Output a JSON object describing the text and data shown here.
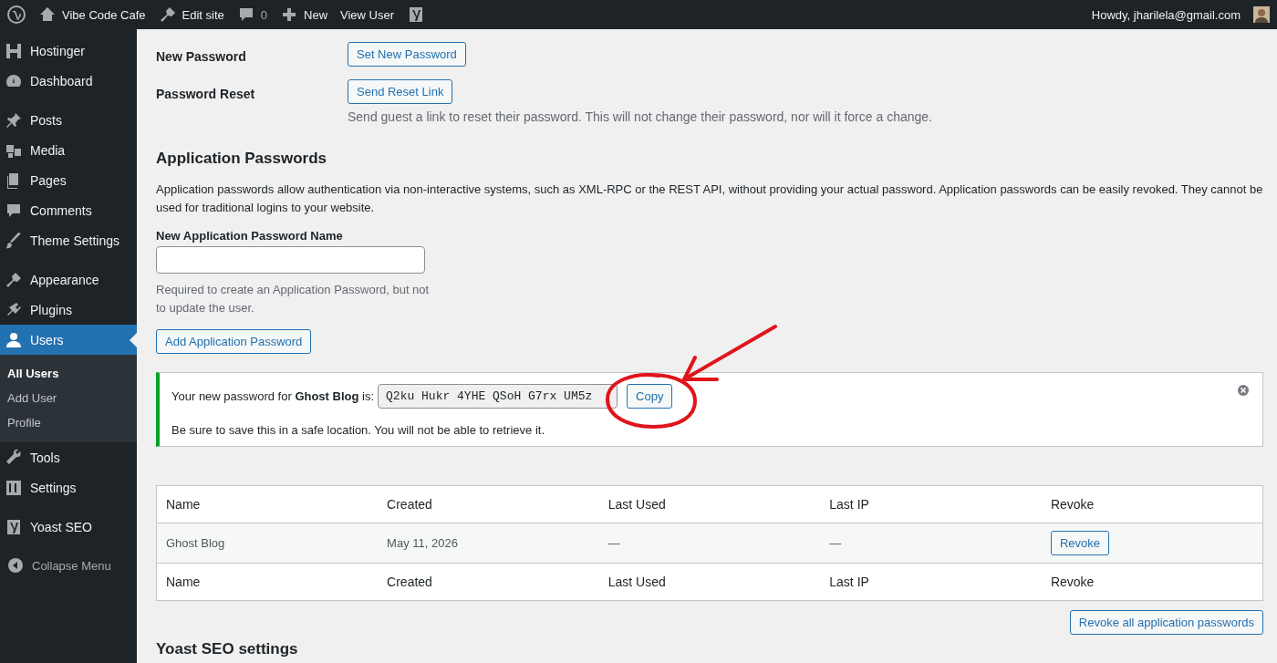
{
  "admin_bar": {
    "site_name": "Vibe Code Cafe",
    "edit_site": "Edit site",
    "comments_count": "0",
    "new": "New",
    "view_user": "View User",
    "howdy": "Howdy, jharilela@gmail.com"
  },
  "sidebar": {
    "sections": [
      [
        {
          "label": "Hostinger",
          "selected": false
        },
        {
          "label": "Dashboard",
          "selected": false
        }
      ],
      [
        {
          "label": "Posts",
          "selected": false
        },
        {
          "label": "Media",
          "selected": false
        },
        {
          "label": "Pages",
          "selected": false
        },
        {
          "label": "Comments",
          "selected": false
        },
        {
          "label": "Theme Settings",
          "selected": false
        }
      ],
      [
        {
          "label": "Appearance",
          "selected": false
        },
        {
          "label": "Plugins",
          "selected": false
        },
        {
          "label": "Users",
          "selected": true,
          "children": [
            {
              "label": "All Users",
              "selected": true
            },
            {
              "label": "Add User",
              "selected": false
            },
            {
              "label": "Profile",
              "selected": false
            }
          ]
        },
        {
          "label": "Tools",
          "selected": false
        },
        {
          "label": "Settings",
          "selected": false
        }
      ],
      [
        {
          "label": "Yoast SEO",
          "selected": false
        }
      ]
    ],
    "collapse_menu": "Collapse Menu"
  },
  "form_rows": [
    {
      "label": "New Password",
      "button": "Set New Password"
    },
    {
      "label": "Password Reset",
      "button": "Send Reset Link",
      "description": "Send guest a link to reset their password. This will not change their password, nor will it force a change."
    }
  ],
  "application_passwords": {
    "title": "Application Passwords",
    "intro": "Application passwords allow authentication via non-interactive systems, such as XML-RPC or the REST API, without providing your actual password. Application passwords can be easily revoked. They cannot be used for traditional logins to your website.",
    "name_label": "New Application Password Name",
    "name_description": "Required to create an Application Password, but not to update the user.",
    "add_button": "Add Application Password",
    "notice": {
      "message": "Your new password for **Ghost Blog** is:",
      "password": "Q2ku Hukr 4YHE QSoH G7rx UM5z",
      "copy_button": "Copy",
      "note": "Be sure to save this in a safe location. You will not be able to retrieve it."
    },
    "table": {
      "columns": [
        "Name",
        "Created",
        "Last Used",
        "Last IP",
        "Revoke"
      ],
      "rows": [
        {
          "cells": [
            "Ghost Blog",
            "May 11, 2026",
            "—",
            "—"
          ],
          "action": "Revoke"
        }
      ],
      "footer": [
        "Name",
        "Created",
        "Last Used",
        "Last IP",
        "Revoke"
      ]
    },
    "revoke_all_button": "Revoke all application passwords"
  },
  "next_section_title": "Yoast SEO settings"
}
